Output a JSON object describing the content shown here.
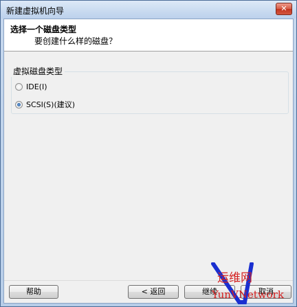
{
  "window": {
    "title": "新建虚拟机向导",
    "close_label": "✕"
  },
  "header": {
    "title": "选择一个磁盘类型",
    "subtitle": "要创建什么样的磁盘？"
  },
  "disk_type_group": {
    "label": "虚拟磁盘类型",
    "options": [
      {
        "label": "IDE(I)",
        "selected": false
      },
      {
        "label": "SCSI(S)(建议)",
        "selected": true
      }
    ]
  },
  "footer": {
    "help_label": "帮助",
    "back_label": "< 返回",
    "next_label": "继续",
    "cancel_label": "取消"
  },
  "watermark": {
    "line1": "运维网",
    "line2": "YunVNetwork"
  },
  "colors": {
    "title_bar": "#c8daf0",
    "close_button": "#c2351f",
    "dialog_bg": "#f0f0f0",
    "watermark_blue": "#1a2fd0",
    "watermark_red": "#d42020"
  }
}
